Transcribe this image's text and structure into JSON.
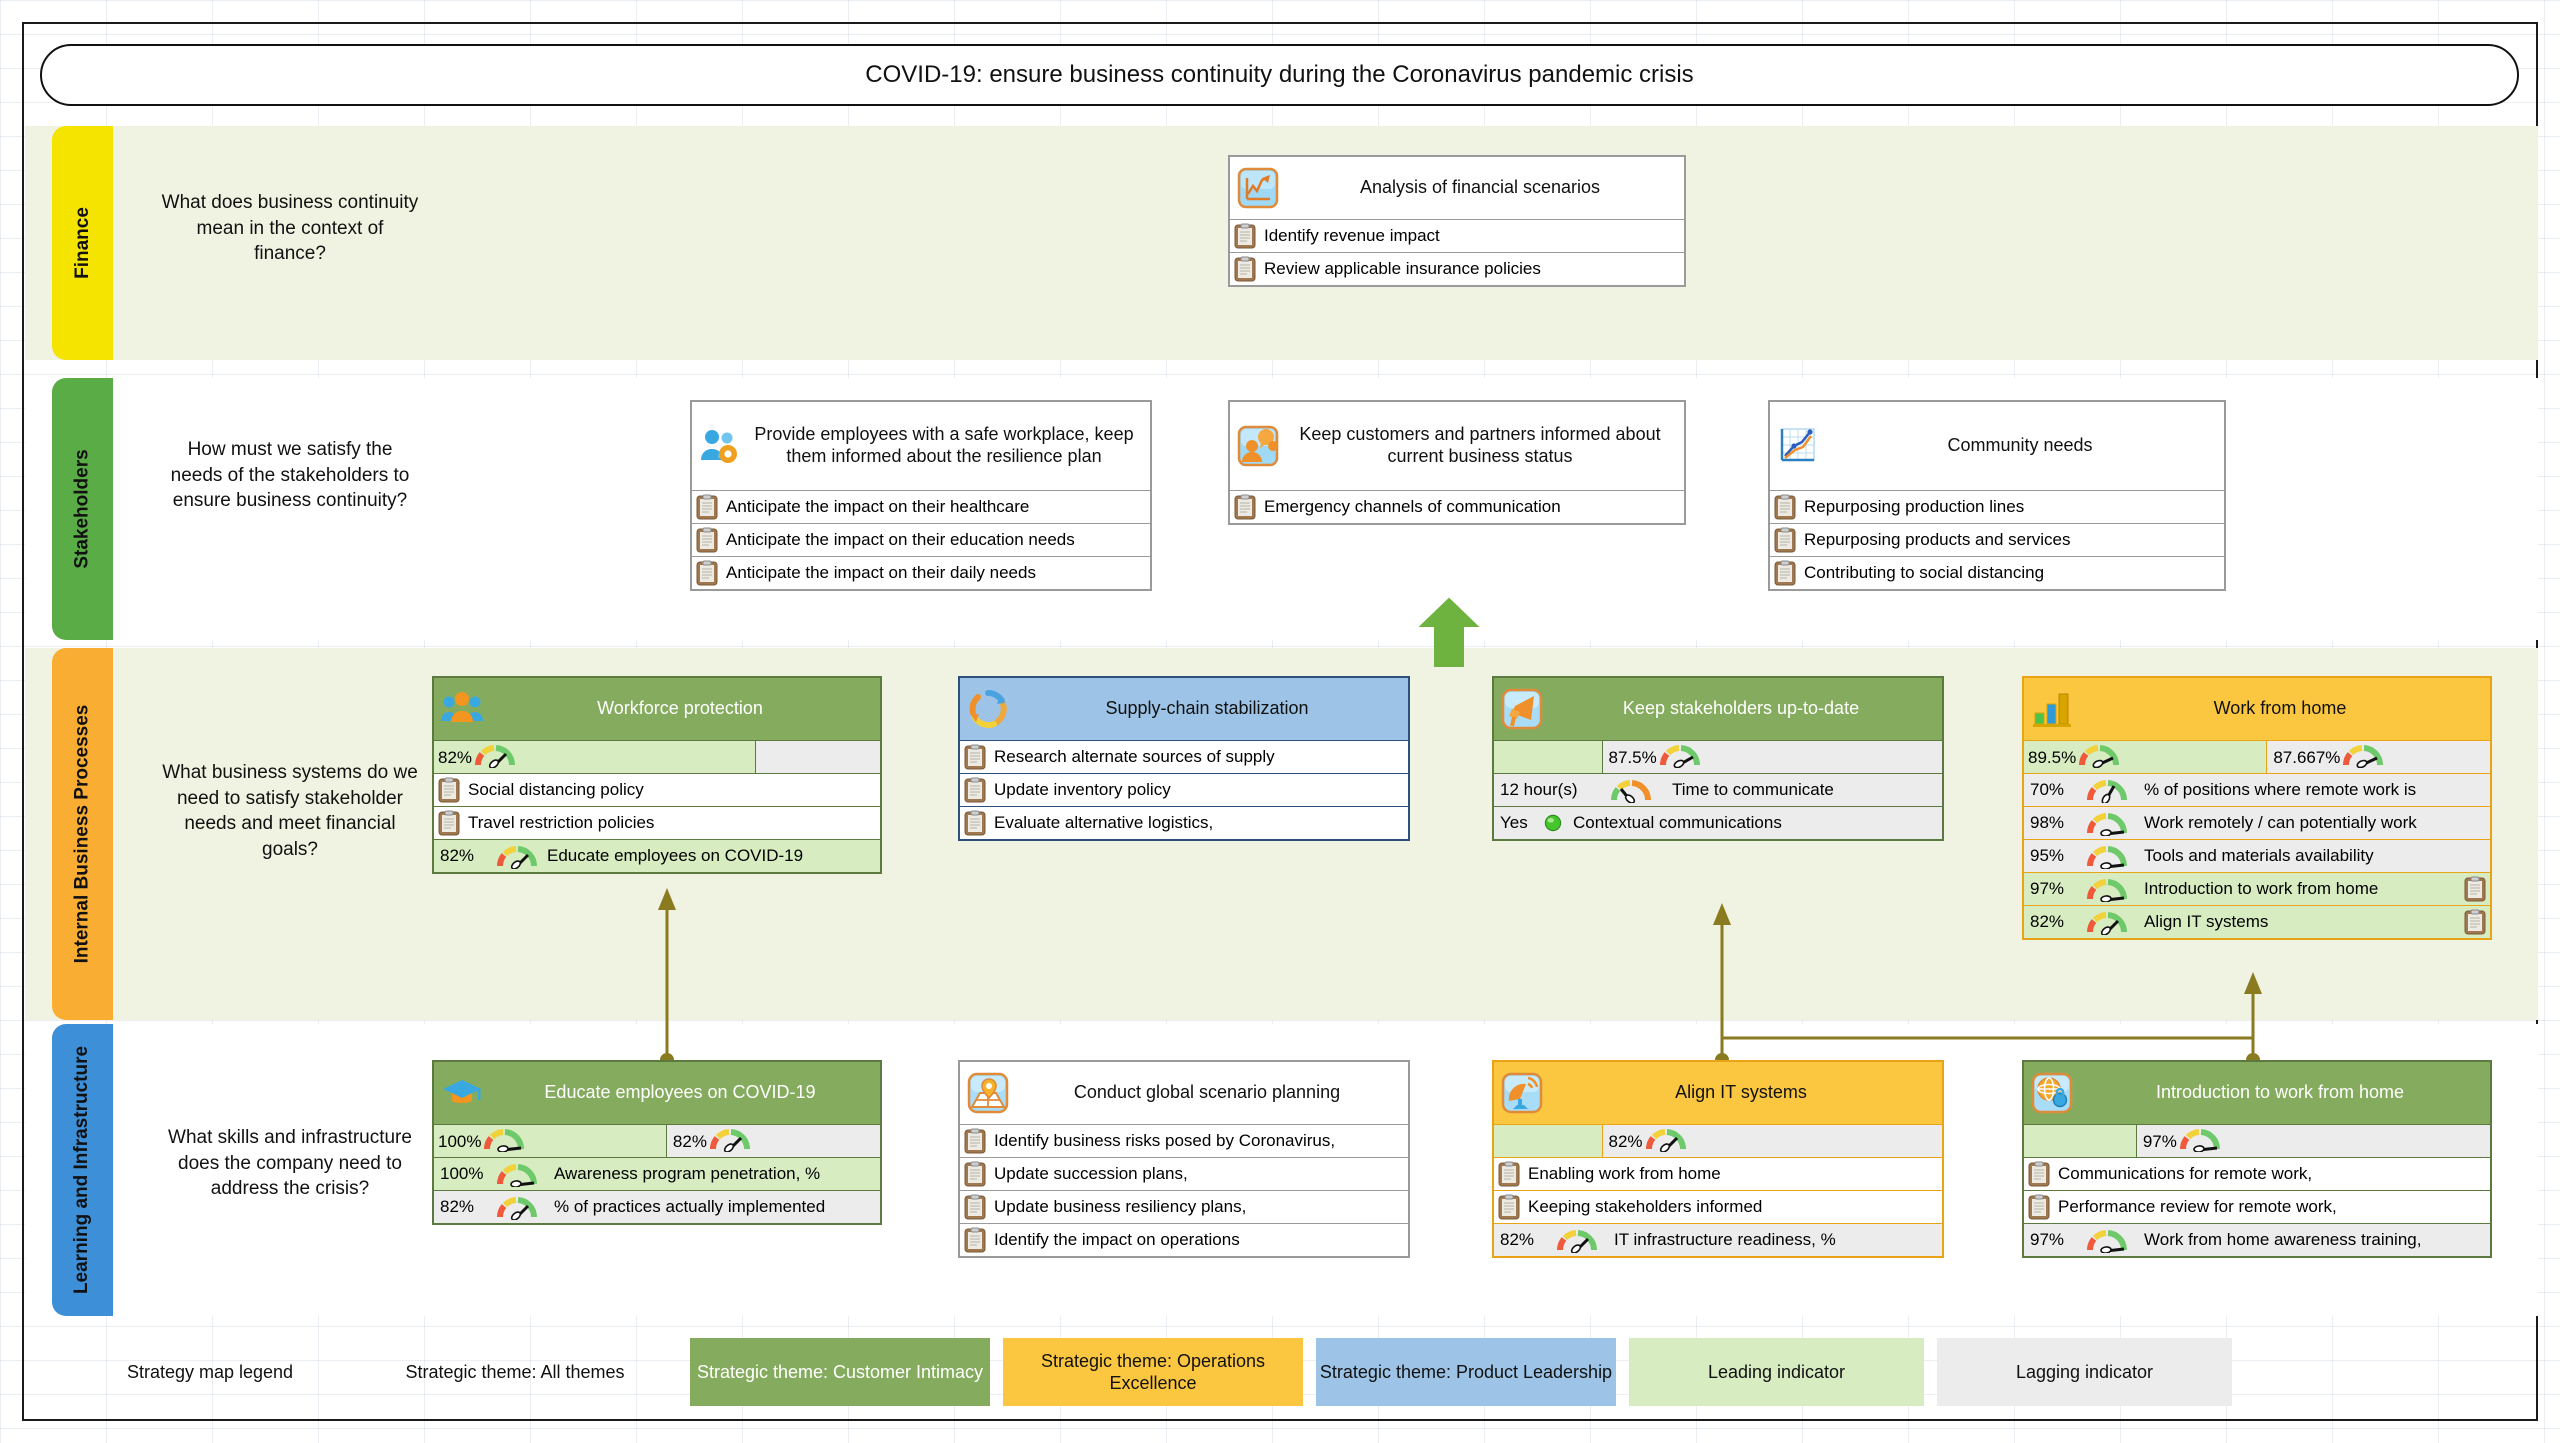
{
  "title": "COVID-19: ensure business continuity during the Coronavirus pandemic crisis",
  "perspectives": [
    {
      "name": "Finance",
      "color": "#f5e400",
      "question": "What does business continuity mean in the context of finance?"
    },
    {
      "name": "Stakeholders",
      "color": "#5aad46",
      "question": "How must we satisfy the needs of the stakeholders to ensure business continuity?"
    },
    {
      "name": "Internal Business Processes",
      "color": "#f9ae33",
      "question": "What business systems do we need to satisfy stakeholder needs and meet financial goals?"
    },
    {
      "name": "Learning and Infrastructure",
      "color": "#3d8fd8",
      "question": "What skills and infrastructure does the company need to address the crisis?"
    }
  ],
  "cards": {
    "analysis_financial": {
      "title": "Analysis of financial scenarios",
      "icon": "line-chart-icon",
      "rows": [
        {
          "type": "initiative",
          "text": "Identify revenue impact"
        },
        {
          "type": "initiative",
          "text": "Review applicable insurance policies"
        }
      ]
    },
    "safe_workplace": {
      "title": "Provide employees with a safe workplace, keep them informed about the resilience plan",
      "icon": "people-gear-icon",
      "rows": [
        {
          "type": "initiative",
          "text": "Anticipate the impact on their healthcare"
        },
        {
          "type": "initiative",
          "text": "Anticipate the impact on their education needs"
        },
        {
          "type": "initiative",
          "text": "Anticipate the impact on their daily needs"
        }
      ]
    },
    "keep_customers": {
      "title": "Keep customers and partners informed about current business status",
      "icon": "person-speech-icon",
      "rows": [
        {
          "type": "initiative",
          "text": "Emergency channels of communication"
        }
      ]
    },
    "community_needs": {
      "title": "Community needs",
      "icon": "trend-chart-icon",
      "rows": [
        {
          "type": "initiative",
          "text": "Repurposing production lines"
        },
        {
          "type": "initiative",
          "text": "Repurposing products and services"
        },
        {
          "type": "initiative",
          "text": "Contributing to social distancing"
        }
      ]
    },
    "workforce_protection": {
      "title": "Workforce protection",
      "icon": "group-people-icon",
      "theme": "Customer Intimacy",
      "progress": {
        "leading_value": "82%",
        "lagging_value": ""
      },
      "rows": [
        {
          "type": "initiative",
          "text": "Social distancing policy"
        },
        {
          "type": "initiative",
          "text": "Travel restriction policies"
        },
        {
          "type": "kpi",
          "value": "82%",
          "text": "Educate employees on COVID-19",
          "indicator": "leading"
        }
      ]
    },
    "supply_chain": {
      "title": "Supply-chain stabilization",
      "icon": "refresh-cycle-icon",
      "theme": "Product Leadership",
      "rows": [
        {
          "type": "initiative",
          "text": "Research alternate sources of supply"
        },
        {
          "type": "initiative",
          "text": "Update inventory policy"
        },
        {
          "type": "initiative",
          "text": "Evaluate alternative logistics,"
        }
      ]
    },
    "keep_stakeholders": {
      "title": "Keep stakeholders up-to-date",
      "icon": "megaphone-icon",
      "theme": "Customer Intimacy",
      "progress": {
        "leading_value": "",
        "lagging_value": "87.5%"
      },
      "rows": [
        {
          "type": "kpi",
          "value": "12 hour(s)",
          "text": "Time to communicate",
          "indicator": "lagging"
        },
        {
          "type": "kpi",
          "value": "Yes",
          "text": "Contextual communications",
          "indicator": "lagging",
          "marker": "green-dot"
        }
      ]
    },
    "work_from_home": {
      "title": "Work from home",
      "icon": "bar-chart-icon",
      "theme": "Operations Excellence",
      "progress": {
        "leading_value": "89.5%",
        "lagging_value": "87.667%"
      },
      "rows": [
        {
          "type": "kpi",
          "value": "70%",
          "text": "% of positions where remote work is",
          "indicator": "lagging"
        },
        {
          "type": "kpi",
          "value": "98%",
          "text": "Work remotely / can potentially work",
          "indicator": "lagging"
        },
        {
          "type": "kpi",
          "value": "95%",
          "text": "Tools and materials availability",
          "indicator": "lagging"
        },
        {
          "type": "kpi",
          "value": "97%",
          "text": "Introduction to work from home",
          "indicator": "leading",
          "clip_right": true
        },
        {
          "type": "kpi",
          "value": "82%",
          "text": "Align IT systems",
          "indicator": "leading",
          "clip_right": true
        }
      ]
    },
    "educate_employees": {
      "title": "Educate employees on COVID-19",
      "icon": "graduation-cap-icon",
      "theme": "Customer Intimacy",
      "progress": {
        "leading_value": "100%",
        "lagging_value": "82%"
      },
      "rows": [
        {
          "type": "kpi",
          "value": "100%",
          "text": "Awareness program penetration, %",
          "indicator": "leading"
        },
        {
          "type": "kpi",
          "value": "82%",
          "text": "% of practices actually implemented",
          "indicator": "lagging"
        }
      ]
    },
    "scenario_planning": {
      "title": "Conduct global scenario planning",
      "icon": "map-pin-icon",
      "rows": [
        {
          "type": "initiative",
          "text": "Identify business risks posed by Coronavirus,"
        },
        {
          "type": "initiative",
          "text": "Update succession plans,"
        },
        {
          "type": "initiative",
          "text": "Update business resiliency plans,"
        },
        {
          "type": "initiative",
          "text": "Identify the impact on operations"
        }
      ]
    },
    "align_it": {
      "title": "Align IT systems",
      "icon": "satellite-dish-icon",
      "theme": "Operations Excellence",
      "progress": {
        "leading_value": "",
        "lagging_value": "82%"
      },
      "rows": [
        {
          "type": "initiative",
          "text": "Enabling work from home"
        },
        {
          "type": "initiative",
          "text": "Keeping stakeholders informed"
        },
        {
          "type": "kpi",
          "value": "82%",
          "text": "IT infrastructure readiness, %",
          "indicator": "lagging"
        }
      ]
    },
    "intro_wfh": {
      "title": "Introduction to work from home",
      "icon": "globe-link-icon",
      "theme": "Customer Intimacy",
      "progress": {
        "leading_value": "",
        "lagging_value": "97%"
      },
      "rows": [
        {
          "type": "initiative",
          "text": "Communications for remote work,"
        },
        {
          "type": "initiative",
          "text": "Performance review for remote work,"
        },
        {
          "type": "kpi",
          "value": "97%",
          "text": "Work from home awareness training,",
          "indicator": "lagging"
        }
      ]
    }
  },
  "legend": {
    "caption": "Strategy map legend",
    "items": [
      {
        "label": "Strategic theme: All themes",
        "color": ""
      },
      {
        "label": "Strategic theme: Customer Intimacy",
        "color": "#85ac5e"
      },
      {
        "label": "Strategic theme: Operations Excellence",
        "color": "#fbc740"
      },
      {
        "label": "Strategic theme: Product Leadership",
        "color": "#9dc3e6"
      },
      {
        "label": "Leading indicator",
        "color": "#d7ecc1"
      },
      {
        "label": "Lagging indicator",
        "color": "#ececed"
      }
    ]
  }
}
